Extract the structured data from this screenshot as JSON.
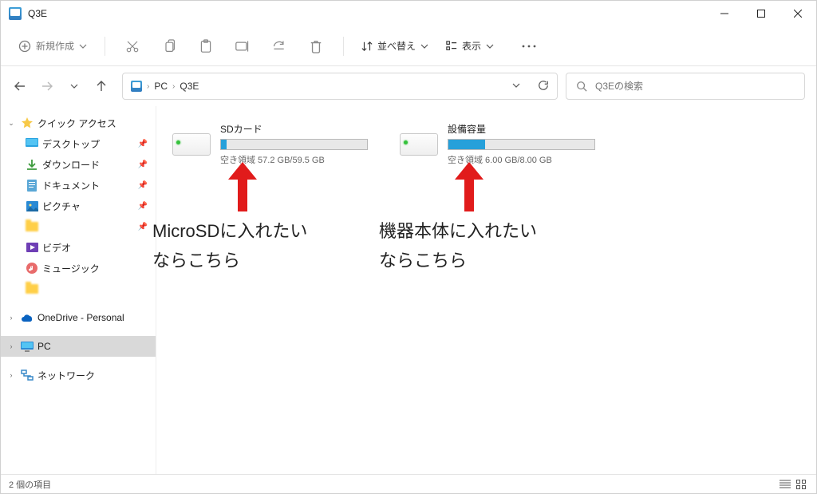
{
  "title": "Q3E",
  "toolbar": {
    "new_label": "新規作成",
    "sort_label": "並べ替え",
    "view_label": "表示"
  },
  "breadcrumb": {
    "root": "PC",
    "current": "Q3E"
  },
  "search": {
    "placeholder": "Q3Eの検索"
  },
  "sidebar": {
    "quick_access": "クイック アクセス",
    "desktop": "デスクトップ",
    "downloads": "ダウンロード",
    "documents": "ドキュメント",
    "pictures": "ピクチャ",
    "hidden1": "　　　　",
    "videos": "ビデオ",
    "music": "ミュージック",
    "hidden2": "　　　",
    "onedrive": "OneDrive - Personal",
    "pc": "PC",
    "network": "ネットワーク"
  },
  "drives": [
    {
      "name": "SDカード",
      "free_text": "空き領域 57.2 GB/59.5 GB",
      "used_percent": 4
    },
    {
      "name": "設備容量",
      "free_text": "空き領域 6.00 GB/8.00 GB",
      "used_percent": 25
    }
  ],
  "annotations": [
    {
      "text": "MicroSDに入れたい\nならこちら"
    },
    {
      "text": "機器本体に入れたい\nならこちら"
    }
  ],
  "status": {
    "item_count": "2 個の項目"
  }
}
